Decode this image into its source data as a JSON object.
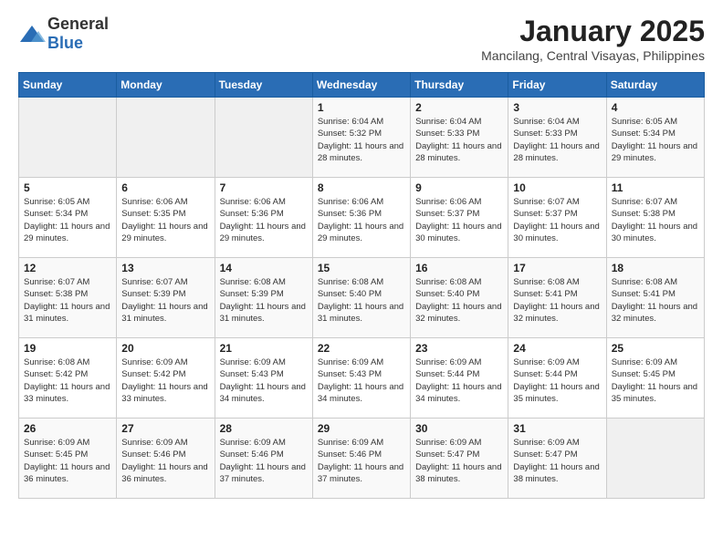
{
  "logo": {
    "general": "General",
    "blue": "Blue"
  },
  "title": "January 2025",
  "subtitle": "Mancilang, Central Visayas, Philippines",
  "header_days": [
    "Sunday",
    "Monday",
    "Tuesday",
    "Wednesday",
    "Thursday",
    "Friday",
    "Saturday"
  ],
  "weeks": [
    [
      {
        "day": "",
        "info": ""
      },
      {
        "day": "",
        "info": ""
      },
      {
        "day": "",
        "info": ""
      },
      {
        "day": "1",
        "info": "Sunrise: 6:04 AM\nSunset: 5:32 PM\nDaylight: 11 hours\nand 28 minutes."
      },
      {
        "day": "2",
        "info": "Sunrise: 6:04 AM\nSunset: 5:33 PM\nDaylight: 11 hours\nand 28 minutes."
      },
      {
        "day": "3",
        "info": "Sunrise: 6:04 AM\nSunset: 5:33 PM\nDaylight: 11 hours\nand 28 minutes."
      },
      {
        "day": "4",
        "info": "Sunrise: 6:05 AM\nSunset: 5:34 PM\nDaylight: 11 hours\nand 29 minutes."
      }
    ],
    [
      {
        "day": "5",
        "info": "Sunrise: 6:05 AM\nSunset: 5:34 PM\nDaylight: 11 hours\nand 29 minutes."
      },
      {
        "day": "6",
        "info": "Sunrise: 6:06 AM\nSunset: 5:35 PM\nDaylight: 11 hours\nand 29 minutes."
      },
      {
        "day": "7",
        "info": "Sunrise: 6:06 AM\nSunset: 5:36 PM\nDaylight: 11 hours\nand 29 minutes."
      },
      {
        "day": "8",
        "info": "Sunrise: 6:06 AM\nSunset: 5:36 PM\nDaylight: 11 hours\nand 29 minutes."
      },
      {
        "day": "9",
        "info": "Sunrise: 6:06 AM\nSunset: 5:37 PM\nDaylight: 11 hours\nand 30 minutes."
      },
      {
        "day": "10",
        "info": "Sunrise: 6:07 AM\nSunset: 5:37 PM\nDaylight: 11 hours\nand 30 minutes."
      },
      {
        "day": "11",
        "info": "Sunrise: 6:07 AM\nSunset: 5:38 PM\nDaylight: 11 hours\nand 30 minutes."
      }
    ],
    [
      {
        "day": "12",
        "info": "Sunrise: 6:07 AM\nSunset: 5:38 PM\nDaylight: 11 hours\nand 31 minutes."
      },
      {
        "day": "13",
        "info": "Sunrise: 6:07 AM\nSunset: 5:39 PM\nDaylight: 11 hours\nand 31 minutes."
      },
      {
        "day": "14",
        "info": "Sunrise: 6:08 AM\nSunset: 5:39 PM\nDaylight: 11 hours\nand 31 minutes."
      },
      {
        "day": "15",
        "info": "Sunrise: 6:08 AM\nSunset: 5:40 PM\nDaylight: 11 hours\nand 31 minutes."
      },
      {
        "day": "16",
        "info": "Sunrise: 6:08 AM\nSunset: 5:40 PM\nDaylight: 11 hours\nand 32 minutes."
      },
      {
        "day": "17",
        "info": "Sunrise: 6:08 AM\nSunset: 5:41 PM\nDaylight: 11 hours\nand 32 minutes."
      },
      {
        "day": "18",
        "info": "Sunrise: 6:08 AM\nSunset: 5:41 PM\nDaylight: 11 hours\nand 32 minutes."
      }
    ],
    [
      {
        "day": "19",
        "info": "Sunrise: 6:08 AM\nSunset: 5:42 PM\nDaylight: 11 hours\nand 33 minutes."
      },
      {
        "day": "20",
        "info": "Sunrise: 6:09 AM\nSunset: 5:42 PM\nDaylight: 11 hours\nand 33 minutes."
      },
      {
        "day": "21",
        "info": "Sunrise: 6:09 AM\nSunset: 5:43 PM\nDaylight: 11 hours\nand 34 minutes."
      },
      {
        "day": "22",
        "info": "Sunrise: 6:09 AM\nSunset: 5:43 PM\nDaylight: 11 hours\nand 34 minutes."
      },
      {
        "day": "23",
        "info": "Sunrise: 6:09 AM\nSunset: 5:44 PM\nDaylight: 11 hours\nand 34 minutes."
      },
      {
        "day": "24",
        "info": "Sunrise: 6:09 AM\nSunset: 5:44 PM\nDaylight: 11 hours\nand 35 minutes."
      },
      {
        "day": "25",
        "info": "Sunrise: 6:09 AM\nSunset: 5:45 PM\nDaylight: 11 hours\nand 35 minutes."
      }
    ],
    [
      {
        "day": "26",
        "info": "Sunrise: 6:09 AM\nSunset: 5:45 PM\nDaylight: 11 hours\nand 36 minutes."
      },
      {
        "day": "27",
        "info": "Sunrise: 6:09 AM\nSunset: 5:46 PM\nDaylight: 11 hours\nand 36 minutes."
      },
      {
        "day": "28",
        "info": "Sunrise: 6:09 AM\nSunset: 5:46 PM\nDaylight: 11 hours\nand 37 minutes."
      },
      {
        "day": "29",
        "info": "Sunrise: 6:09 AM\nSunset: 5:46 PM\nDaylight: 11 hours\nand 37 minutes."
      },
      {
        "day": "30",
        "info": "Sunrise: 6:09 AM\nSunset: 5:47 PM\nDaylight: 11 hours\nand 38 minutes."
      },
      {
        "day": "31",
        "info": "Sunrise: 6:09 AM\nSunset: 5:47 PM\nDaylight: 11 hours\nand 38 minutes."
      },
      {
        "day": "",
        "info": ""
      }
    ]
  ]
}
